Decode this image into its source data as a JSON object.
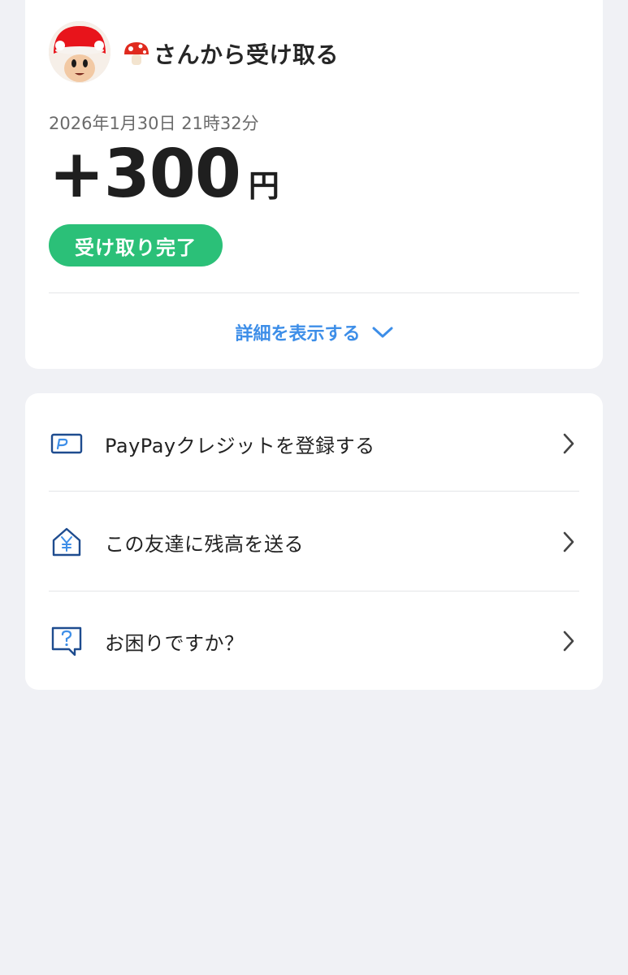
{
  "transaction": {
    "title": "🍄さんから受け取る",
    "title_text": "さんから受け取る",
    "date": "2026年1月30日 21時32分",
    "amount": "+300",
    "currency_unit": "円",
    "status": "受け取り完了",
    "details_toggle": "詳細を表示する"
  },
  "menu": {
    "items": [
      {
        "label": "PayPayクレジットを登録する",
        "icon": "paypay-card-icon"
      },
      {
        "label": "この友達に残高を送る",
        "icon": "house-yen-icon"
      },
      {
        "label": "お困りですか？",
        "icon": "help-chat-icon"
      }
    ]
  },
  "colors": {
    "background": "#f0f1f5",
    "card": "#ffffff",
    "status_green": "#2bc078",
    "link_blue": "#3d8ee8",
    "icon_navy": "#1e4c8f"
  }
}
